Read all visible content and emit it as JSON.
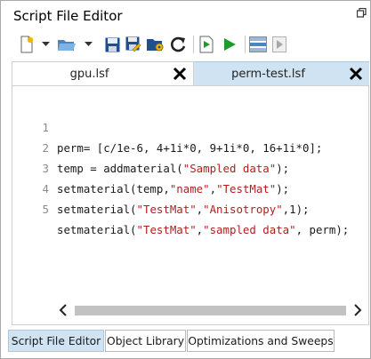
{
  "window": {
    "title": "Script File Editor"
  },
  "toolbar": {
    "buttons": [
      {
        "name": "new-script",
        "icon": "new-file-icon"
      },
      {
        "name": "new-dropdown",
        "icon": "chevron-down-icon"
      },
      {
        "name": "open-script",
        "icon": "open-folder-icon"
      },
      {
        "name": "open-dropdown",
        "icon": "chevron-down-icon"
      },
      {
        "name": "save",
        "icon": "save-icon"
      },
      {
        "name": "save-as",
        "icon": "save-as-icon"
      },
      {
        "name": "change-directory",
        "icon": "folder-gear-icon"
      },
      {
        "name": "refresh",
        "icon": "refresh-icon"
      },
      {
        "name": "run-to-cursor",
        "icon": "run-to-cursor-icon"
      },
      {
        "name": "run-script",
        "icon": "play-icon"
      },
      {
        "name": "split-view",
        "icon": "split-view-icon"
      },
      {
        "name": "step",
        "icon": "step-icon"
      }
    ]
  },
  "file_tabs": [
    {
      "label": "gpu.lsf",
      "active": false
    },
    {
      "label": "perm-test.lsf",
      "active": true
    }
  ],
  "editor": {
    "lines": [
      {
        "number": "1",
        "code": "perm= [c/1e-6, 4+1i*0, 9+1i*0, 16+1i*0];"
      },
      {
        "number": "2",
        "pre": "temp = addmaterial(",
        "str": "\"Sampled data\"",
        "post": ");"
      },
      {
        "number": "3",
        "pre": "setmaterial(temp,",
        "str": "\"name\"",
        "mid": ",",
        "str2": "\"TestMat\"",
        "post": ");"
      },
      {
        "number": "4",
        "pre": "setmaterial(",
        "str": "\"TestMat\"",
        "mid": ",",
        "str2": "\"Anisotropy\"",
        "post": ",1);"
      },
      {
        "number": "5",
        "pre": "setmaterial(",
        "str": "\"TestMat\"",
        "mid": ",",
        "str2": "\"sampled data\"",
        "post": ", perm);"
      }
    ]
  },
  "bottom_tabs": [
    {
      "label": "Script File Editor",
      "active": true
    },
    {
      "label": "Object Library",
      "active": false
    },
    {
      "label": "Optimizations and Sweeps",
      "active": false
    }
  ],
  "colors": {
    "active_tab": "#cfe3f3",
    "string": "#b21e1e",
    "run_green": "#1c9c2a",
    "save_blue": "#1f4f8f"
  }
}
